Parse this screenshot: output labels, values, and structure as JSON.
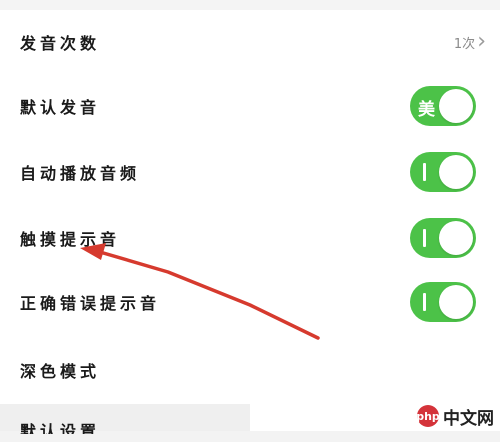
{
  "settings": {
    "pronounce_count": {
      "label": "发音次数",
      "value": "1次",
      "chevron": "›"
    },
    "default_pronounce": {
      "label": "默认发音",
      "toggle_text": "美",
      "on": true
    },
    "autoplay_audio": {
      "label": "自动播放音频",
      "on": true
    },
    "touch_sound": {
      "label": "触摸提示音",
      "on": true
    },
    "correct_wrong_sound": {
      "label": "正确错误提示音",
      "on": true
    },
    "dark_mode": {
      "label": "深色模式"
    },
    "next_item_partial": "默认设置"
  },
  "annotation": {
    "type": "arrow",
    "color": "#d63a2e",
    "points_to": "触摸提示音"
  },
  "watermark": {
    "logo_text": "php",
    "text": "中文网"
  },
  "colors": {
    "toggle_on": "#4cc248",
    "text": "#1a1a1a",
    "secondary": "#8a8a8a"
  }
}
